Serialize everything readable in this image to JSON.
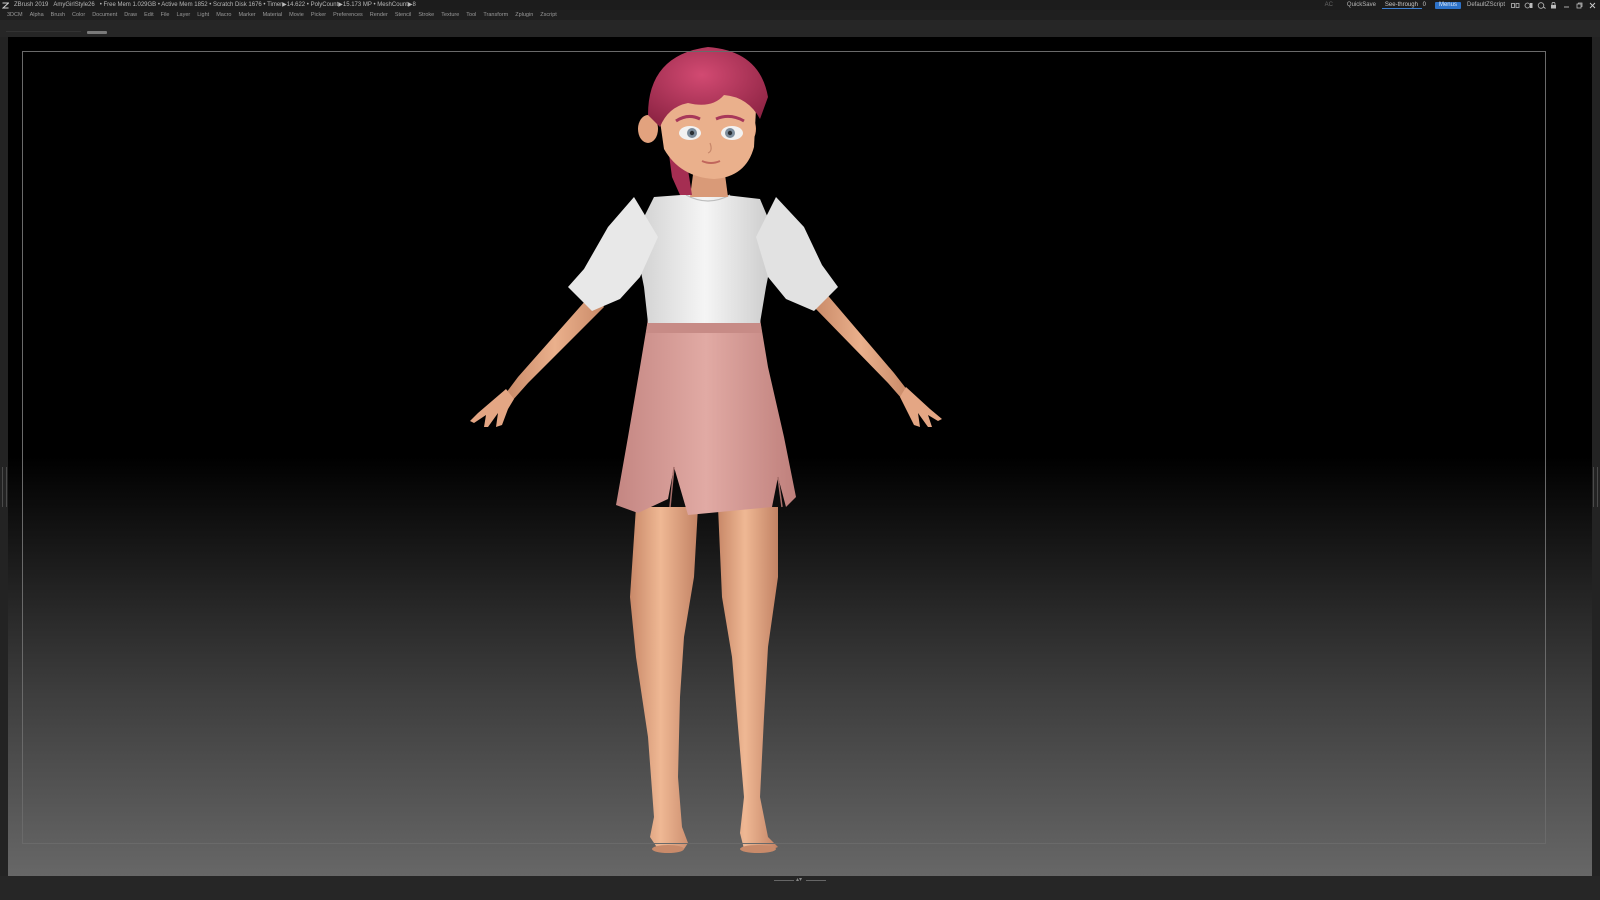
{
  "titlebar": {
    "app_name": "ZBrush 2019",
    "document_name": "AmyGirlStyle26",
    "status": "• Free Mem 1.029GB • Active Mem 1852 • Scratch Disk 1676 • Timer▶14.622 • PolyCount▶15.173 MP • MeshCount▶8",
    "ac_label": "AC",
    "quicksave_label": "QuickSave",
    "seethrough_label": "See-through",
    "seethrough_value": "0",
    "seethrough_fraction": 0,
    "menus_label": "Menus",
    "script_label": "DefaultZScript",
    "accent_color": "#2d72c8"
  },
  "menubar": {
    "items": [
      "3DCM",
      "Alpha",
      "Brush",
      "Color",
      "Document",
      "Draw",
      "Edit",
      "File",
      "Layer",
      "Light",
      "Macro",
      "Marker",
      "Material",
      "Movie",
      "Picker",
      "Preferences",
      "Render",
      "Stencil",
      "Stroke",
      "Texture",
      "Tool",
      "Transform",
      "Zplugin",
      "Zscript"
    ]
  },
  "icons": {
    "logo": "zbrush-logo-icon",
    "window_controls": [
      "layout-icon",
      "theme-icon",
      "help-icon",
      "lock-icon",
      "minimize-icon",
      "restore-icon",
      "close-icon"
    ]
  },
  "canvas": {
    "subject": "stylized-girl-character-model",
    "colors": {
      "hair": "#b8385e",
      "skin": "#e6a882",
      "blouse": "#ededed",
      "skirt": "#d9a09a"
    }
  }
}
